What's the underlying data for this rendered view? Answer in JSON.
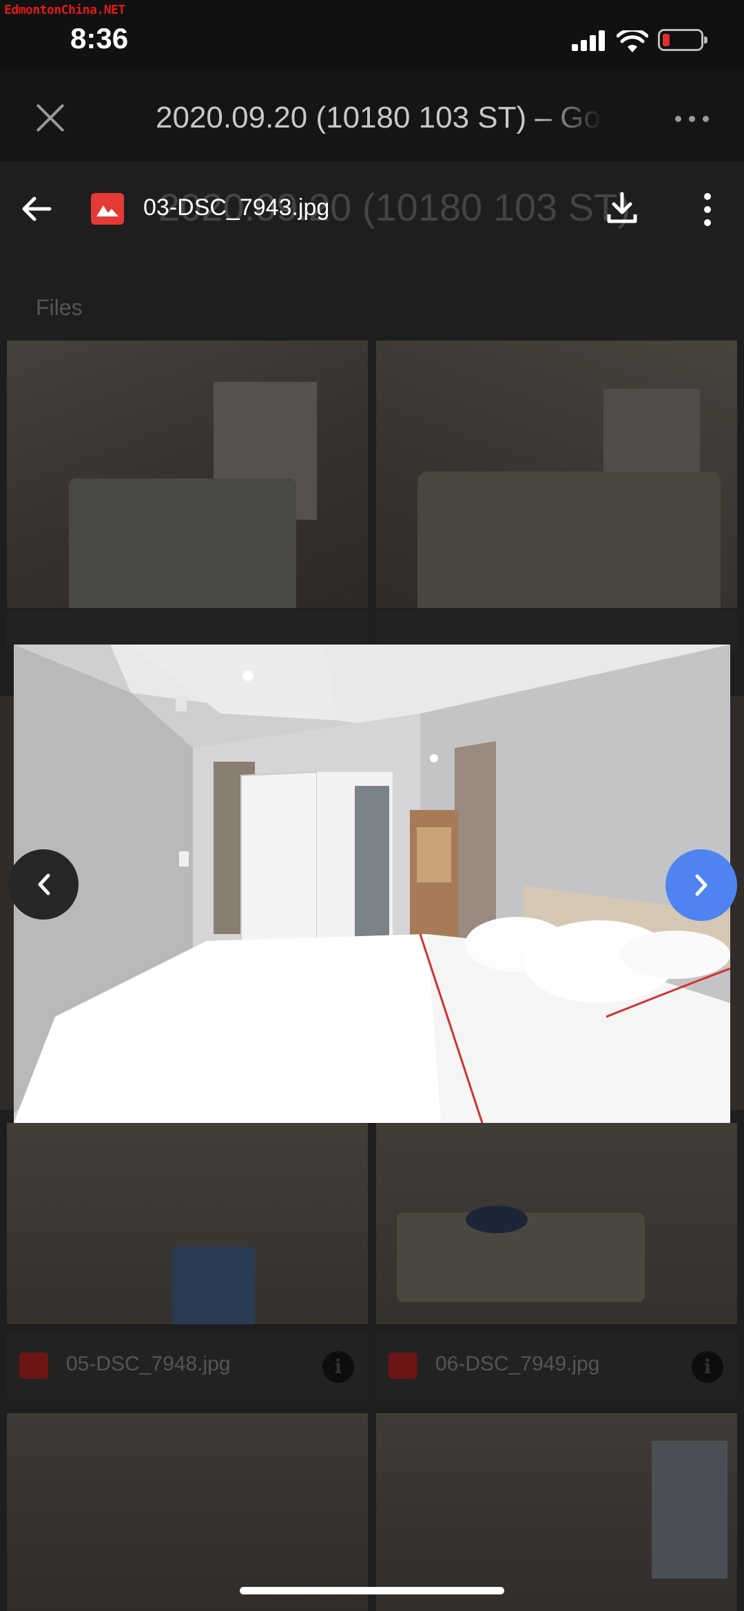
{
  "watermark": "EdmontonChina.NET",
  "status_bar": {
    "time": "8:36"
  },
  "browser": {
    "title": "2020.09.20 (10180 103 ST) – Go"
  },
  "background_page": {
    "header_text": "2020.09.20 (10180 103 ST)",
    "section_label": "Files",
    "files": [
      {
        "name": "05-DSC_7948.jpg"
      },
      {
        "name": "06-DSC_7949.jpg"
      }
    ]
  },
  "viewer": {
    "filename": "03-DSC_7943.jpg"
  },
  "colors": {
    "accent_blue": "#4f84f0",
    "file_icon_red": "#e53935",
    "status_bar": "#111111"
  },
  "icons": {
    "close": "close-icon",
    "more": "more-horizontal-icon",
    "back": "arrow-left-icon",
    "download": "download-icon",
    "kebab": "more-vertical-icon",
    "prev": "chevron-left-icon",
    "next": "chevron-right-icon",
    "info": "info-icon",
    "image_file": "image-file-icon"
  }
}
